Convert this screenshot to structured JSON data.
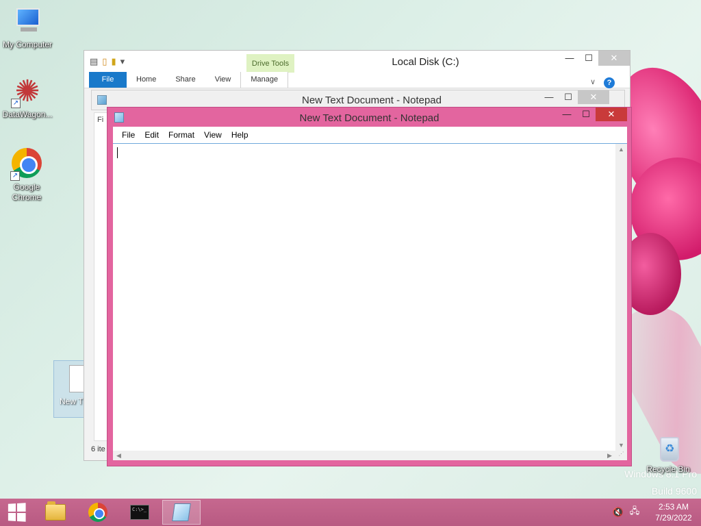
{
  "desktop": {
    "icons": [
      {
        "label": "My Computer"
      },
      {
        "label": "DataWagon..."
      },
      {
        "label": "Google Chrome"
      },
      {
        "label": "Recycle Bin"
      }
    ],
    "partial_file_label": "New T Docur",
    "watermark_line1": "Windows 8.1 Pro",
    "watermark_line2": "Build 9600"
  },
  "explorer": {
    "title": "Local Disk (C:)",
    "contextual_tab": "Drive Tools",
    "tabs": [
      "File",
      "Home",
      "Share",
      "View",
      "Manage"
    ],
    "sidebar_label": "Fi",
    "status": "6 ite"
  },
  "notepad_back": {
    "title": "New Text Document - Notepad"
  },
  "notepad": {
    "title": "New Text Document - Notepad",
    "menu": [
      "File",
      "Edit",
      "Format",
      "View",
      "Help"
    ],
    "content": ""
  },
  "window_controls": {
    "minimize": "—",
    "maximize": "☐",
    "close": "✕"
  },
  "taskbar": {
    "apps": [
      "File Explorer",
      "Google Chrome",
      "Command Prompt",
      "Notepad"
    ],
    "active_app": "Notepad",
    "time": "2:53 AM",
    "date": "7/29/2022"
  },
  "colors": {
    "notepad_frame": "#e3659f",
    "close_active": "#c93a3a",
    "ribbon_file": "#1979ca",
    "taskbar": "#c6688f"
  }
}
